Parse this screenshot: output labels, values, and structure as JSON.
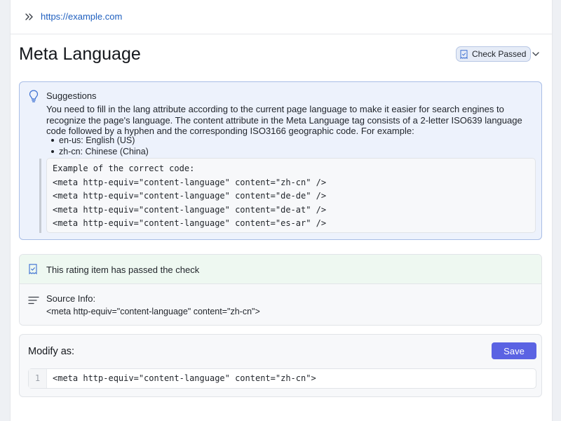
{
  "url_bar": {
    "url": "https://example.com",
    "expand_icon": "double-chevron-right-icon"
  },
  "header": {
    "title": "Meta Language",
    "status_badge": "Check Passed",
    "status_icon": "receipt-check-icon",
    "dropdown_icon": "chevron-down-icon"
  },
  "suggestions": {
    "icon": "lightbulb-icon",
    "title": "Suggestions",
    "body": "You need to fill in the lang attribute according to the current page language to make it easier for search engines to recognize the page's language. The content attribute in the Meta Language tag consists of a 2-letter ISO639 language code followed by a hyphen and the corresponding ISO3166 geographic code. For example:",
    "examples": [
      "en-us: English (US)",
      "zh-cn: Chinese (China)"
    ],
    "code_lines": [
      "Example of the correct code:",
      "<meta http-equiv=\"content-language\" content=\"zh-cn\" />",
      "<meta http-equiv=\"content-language\" content=\"de-de\" />",
      "<meta http-equiv=\"content-language\" content=\"de-at\" />",
      "<meta http-equiv=\"content-language\" content=\"es-ar\" />"
    ]
  },
  "result": {
    "pass_icon": "receipt-check-icon",
    "pass_text": "This rating item has passed the check",
    "source_icon": "text-lines-icon",
    "source_title": "Source Info:",
    "source_value": "<meta http-equiv=\"content-language\" content=\"zh-cn\">"
  },
  "modify": {
    "title": "Modify as:",
    "save_label": "Save",
    "line_number": "1",
    "code": "<meta http-equiv=\"content-language\" content=\"zh-cn\">"
  },
  "colors": {
    "accent": "#5b63e3",
    "link": "#1f5fbf",
    "suggestion_bg": "#edf2fc",
    "suggestion_border": "#a8bde6",
    "pass_bg": "#eef8f1"
  }
}
